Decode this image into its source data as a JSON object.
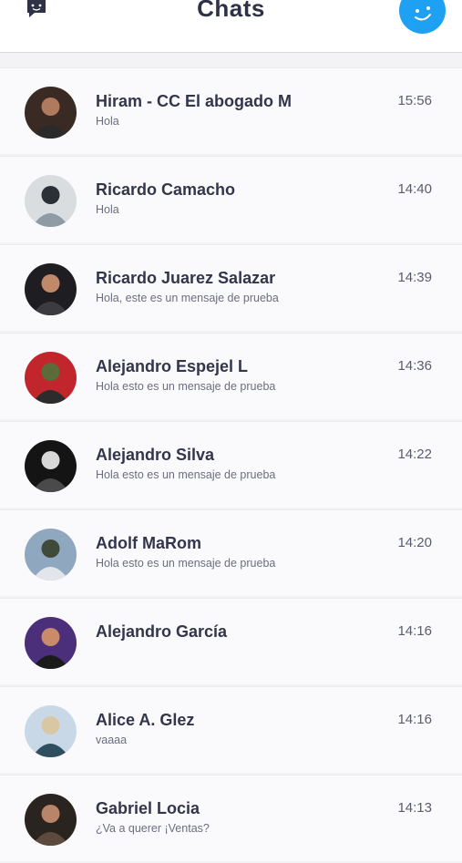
{
  "header": {
    "title": "Chats",
    "compose_icon": "compose-chat-icon",
    "new_chat_icon": "smiley-icon",
    "accent_color": "#1ea1f2"
  },
  "chats": [
    {
      "name": "Hiram - CC El abogado M",
      "preview": "Hola",
      "time": "15:56",
      "avatar_colors": [
        "#3a2a24",
        "#b07a5e",
        "#2a2a2a"
      ]
    },
    {
      "name": "Ricardo Camacho",
      "preview": "Hola",
      "time": "14:40",
      "avatar_colors": [
        "#d9dde0",
        "#2b2f36",
        "#8e9aa4"
      ]
    },
    {
      "name": "Ricardo Juarez Salazar",
      "preview": "Hola, este es un mensaje de prueba",
      "time": "14:39",
      "avatar_colors": [
        "#1e1e22",
        "#c08a6a",
        "#3b3b40"
      ]
    },
    {
      "name": "Alejandro Espejel L",
      "preview": "Hola esto es un mensaje de prueba",
      "time": "14:36",
      "avatar_colors": [
        "#c0262c",
        "#5b6b3a",
        "#2c2c2c"
      ]
    },
    {
      "name": "Alejandro Silva",
      "preview": "Hola esto es un mensaje de prueba",
      "time": "14:22",
      "avatar_colors": [
        "#141414",
        "#d8d8d8",
        "#4a4a4a"
      ]
    },
    {
      "name": "Adolf MaRom",
      "preview": "Hola esto es un mensaje de prueba",
      "time": "14:20",
      "avatar_colors": [
        "#8fa7bf",
        "#3f4a3a",
        "#e2e6ea"
      ]
    },
    {
      "name": "Alejandro García",
      "preview": "",
      "time": "14:16",
      "avatar_colors": [
        "#4b2f7a",
        "#c98b6a",
        "#1b1b1b"
      ]
    },
    {
      "name": "Alice A. Glez",
      "preview": "vaaaa",
      "time": "14:16",
      "avatar_colors": [
        "#c9d8e6",
        "#d9c7a4",
        "#2f4f5f"
      ]
    },
    {
      "name": "Gabriel Locia",
      "preview": "¿Va a querer ¡Ventas?",
      "time": "14:13",
      "avatar_colors": [
        "#2a2420",
        "#b9856a",
        "#5c4a3e"
      ]
    }
  ]
}
